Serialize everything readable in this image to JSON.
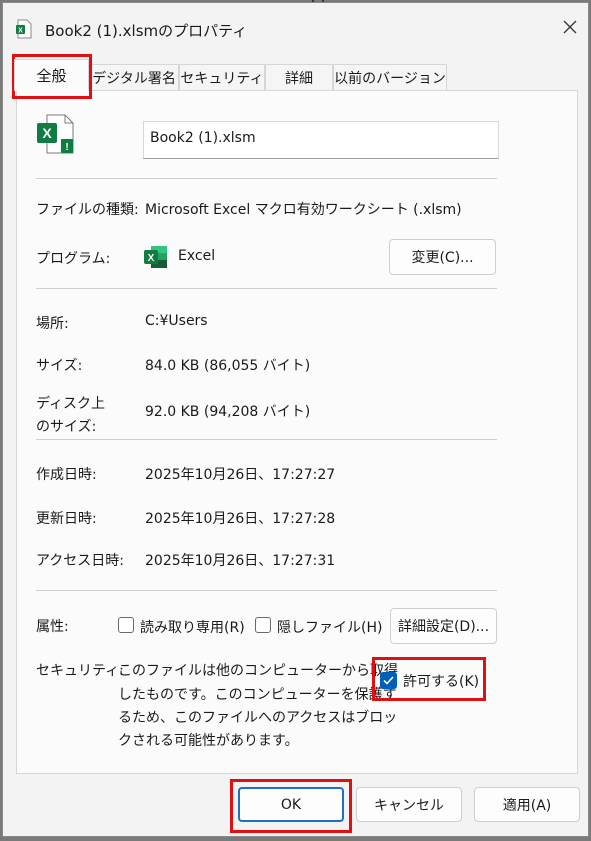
{
  "window": {
    "title": "Book2 (1).xlsmのプロパティ"
  },
  "tabs": [
    {
      "label": "全般"
    },
    {
      "label": "デジタル署名"
    },
    {
      "label": "セキュリティ"
    },
    {
      "label": "詳細"
    },
    {
      "label": "以前のバージョン"
    }
  ],
  "general": {
    "file_name": "Book2 (1).xlsm",
    "file_type_label": "ファイルの種類:",
    "file_type_value": "Microsoft Excel マクロ有効ワークシート (.xlsm)",
    "program_label": "プログラム:",
    "program_value": "Excel",
    "change_button": "変更(C)...",
    "location_label": "場所:",
    "location_value": "C:¥Users",
    "size_label": "サイズ:",
    "size_value": "84.0 KB (86,055 バイト)",
    "disk_size_label_1": "ディスク上",
    "disk_size_label_2": "のサイズ:",
    "disk_size_value": "92.0 KB (94,208 バイト)",
    "created_label": "作成日時:",
    "created_value": "2025年10月26日、17:27:27",
    "modified_label": "更新日時:",
    "modified_value": "2025年10月26日、17:27:28",
    "accessed_label": "アクセス日時:",
    "accessed_value": "2025年10月26日、17:27:31",
    "attributes_label": "属性:",
    "readonly_label": "読み取り専用(R)",
    "readonly_checked": false,
    "hidden_label": "隠しファイル(H)",
    "hidden_checked": false,
    "advanced_button": "詳細設定(D)...",
    "security_label": "セキュリティ:",
    "security_text_1": "このファイルは他のコンピューターから取得",
    "security_text_2": "したものです。このコンピューターを保護す",
    "security_text_3": "るため、このファイルへのアクセスはブロッ",
    "security_text_4": "クされる可能性があります。",
    "unblock_label": "許可する(K)",
    "unblock_checked": true
  },
  "footer": {
    "ok": "OK",
    "cancel": "キャンセル",
    "apply": "適用(A)"
  },
  "colors": {
    "excel_green": "#107c41",
    "accent_blue": "#005fb8",
    "highlight_red": "#e01010"
  }
}
